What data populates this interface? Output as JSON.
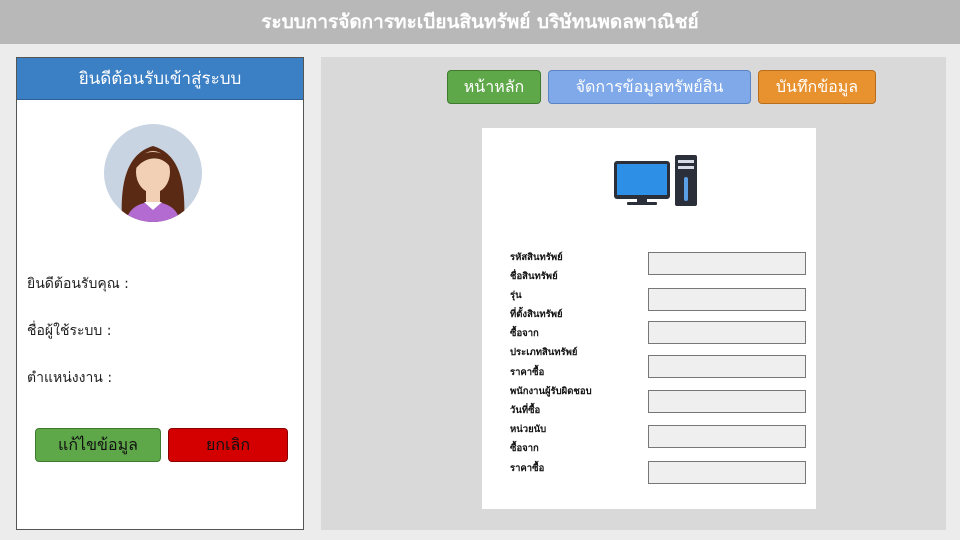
{
  "app": {
    "title": "ระบบการจัดการทะเบียนสินทรัพย์ บริษัทนพดลพาณิชย์"
  },
  "sidebar": {
    "header": "ยินดีต้อนรับเข้าสู่ระบบ",
    "welcome_label": "ยินดีต้อนรับคุณ :",
    "username_label": "ชื่อผู้ใช้ระบบ :",
    "position_label": "ตำแหน่งงาน :",
    "edit_button": "แก้ไขข้อมูล",
    "cancel_button": "ยกเลิก"
  },
  "nav": {
    "home": "หน้าหลัก",
    "manage": "จัดการข้อมูลทรัพย์สิน",
    "save": "บันทึกข้อมูล"
  },
  "form": {
    "labels": [
      "รหัสสินทรัพย์",
      "ชื่อสินทรัพย์",
      "รุ่น",
      "ที่ตั้งสินทรัพย์",
      "ซื้อจาก",
      "ประเภทสินทรัพย์",
      "ราคาซื้อ",
      "พนักงานผู้รับผิดชอบ",
      "วันที่ซื้อ",
      "หน่วยนับ",
      "ซื้อจาก",
      "ราคาซื้อ"
    ],
    "field_values": [
      "",
      "",
      "",
      "",
      "",
      "",
      ""
    ]
  },
  "icons": {
    "avatar": "user-avatar-icon",
    "computer": "computer-icon"
  },
  "colors": {
    "header_bg": "#b8b8b8",
    "sidebar_header": "#3b7fc4",
    "green": "#5fa84a",
    "red": "#d40000",
    "blue": "#7fa9e8",
    "orange": "#e8912f"
  }
}
